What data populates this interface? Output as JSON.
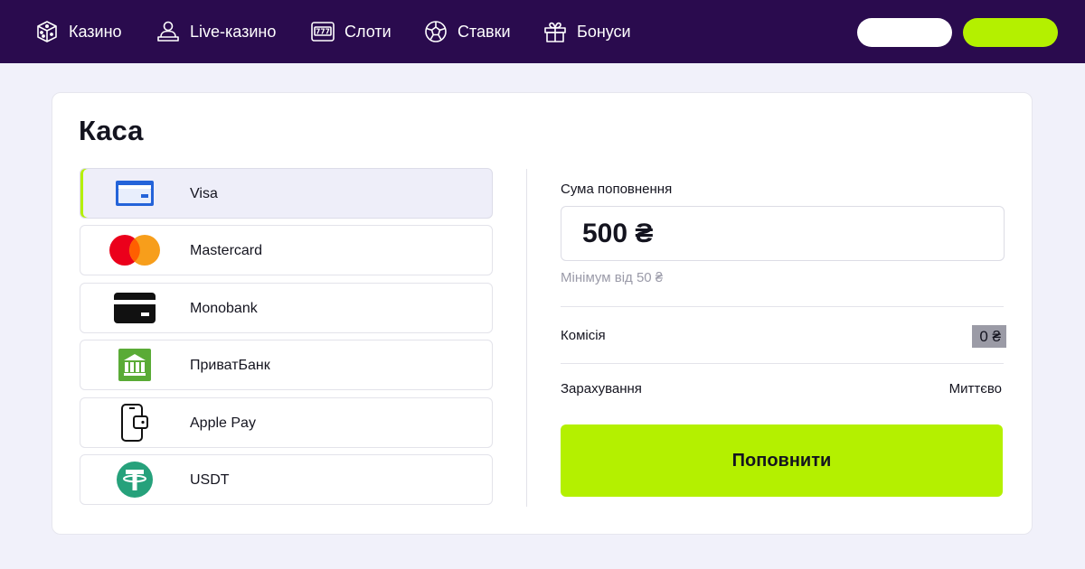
{
  "nav": {
    "items": [
      {
        "label": "Казино",
        "icon": "dice-icon"
      },
      {
        "label": "Live-казино",
        "icon": "dealer-icon"
      },
      {
        "label": "Слоти",
        "icon": "slot-machine-icon"
      },
      {
        "label": "Ставки",
        "icon": "ball-icon"
      },
      {
        "label": "Бонуси",
        "icon": "gift-icon"
      }
    ]
  },
  "cashier": {
    "title": "Каса",
    "methods": [
      {
        "label": "Visa",
        "icon": "card-icon",
        "selected": true
      },
      {
        "label": "Mastercard",
        "icon": "mastercard-icon"
      },
      {
        "label": "Monobank",
        "icon": "card-icon"
      },
      {
        "label": "ПриватБанк",
        "icon": "bank-icon"
      },
      {
        "label": "Apple Pay",
        "icon": "phone-wallet-icon"
      },
      {
        "label": "USDT",
        "icon": "tether-icon"
      }
    ],
    "amount_label": "Сума поповнення",
    "amount_value": "500 ₴",
    "amount_hint": "Мінімум від 50 ₴",
    "fee_label": "Комісія",
    "fee_value": "0 ₴",
    "credit_label": "Зарахування",
    "credit_value": "Миттєво",
    "submit_label": "Поповнити"
  },
  "colors": {
    "topbar": "#2a0b4e",
    "accent": "#b4f000",
    "background": "#f1f1fa",
    "selected_method": "#eeeef9"
  }
}
